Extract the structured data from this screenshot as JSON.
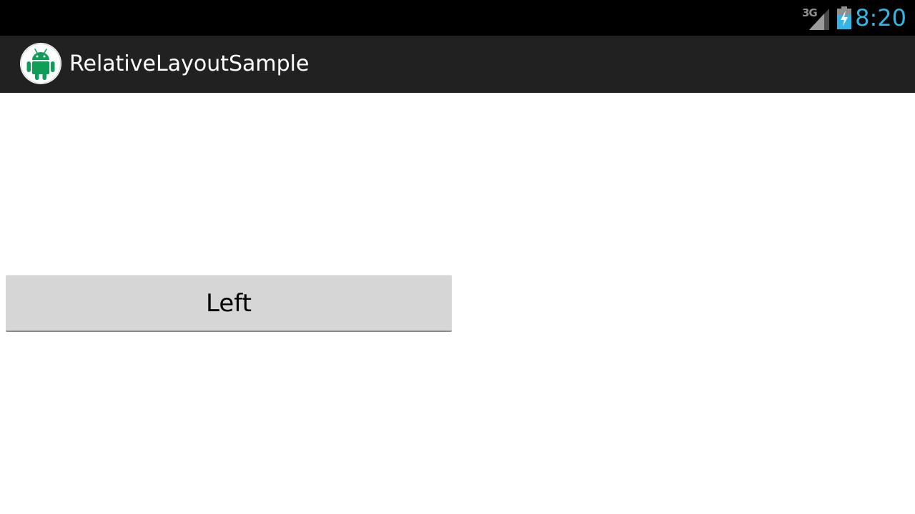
{
  "status_bar": {
    "network_label": "3G",
    "time": "8:20",
    "icons": [
      "signal-icon",
      "battery-charging-icon"
    ],
    "time_color": "#33b5e5"
  },
  "action_bar": {
    "title": "RelativeLayoutSample",
    "icon": "android-robot-icon",
    "icon_color": "#0f9d58"
  },
  "content": {
    "left_button_label": "Left"
  }
}
